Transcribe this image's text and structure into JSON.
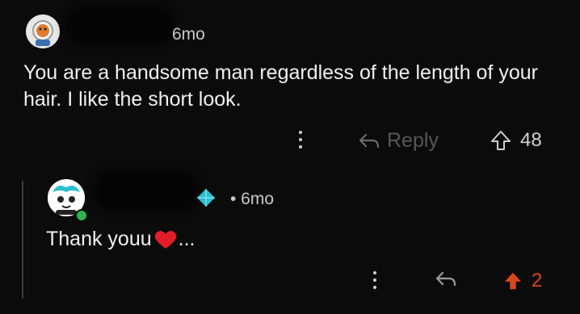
{
  "comment": {
    "time": "6mo",
    "text": "You are a handsome man regardless of the length of your hair. I like the short look.",
    "reply_label": "Reply",
    "votes": "48"
  },
  "reply": {
    "time": "• 6mo",
    "text": "Thank youu",
    "text_suffix": "...",
    "votes": "2"
  },
  "colors": {
    "background": "#0b0b0b",
    "upvote_active": "#d8471a",
    "online": "#2fb34a",
    "flair": "#2bbfd0"
  }
}
